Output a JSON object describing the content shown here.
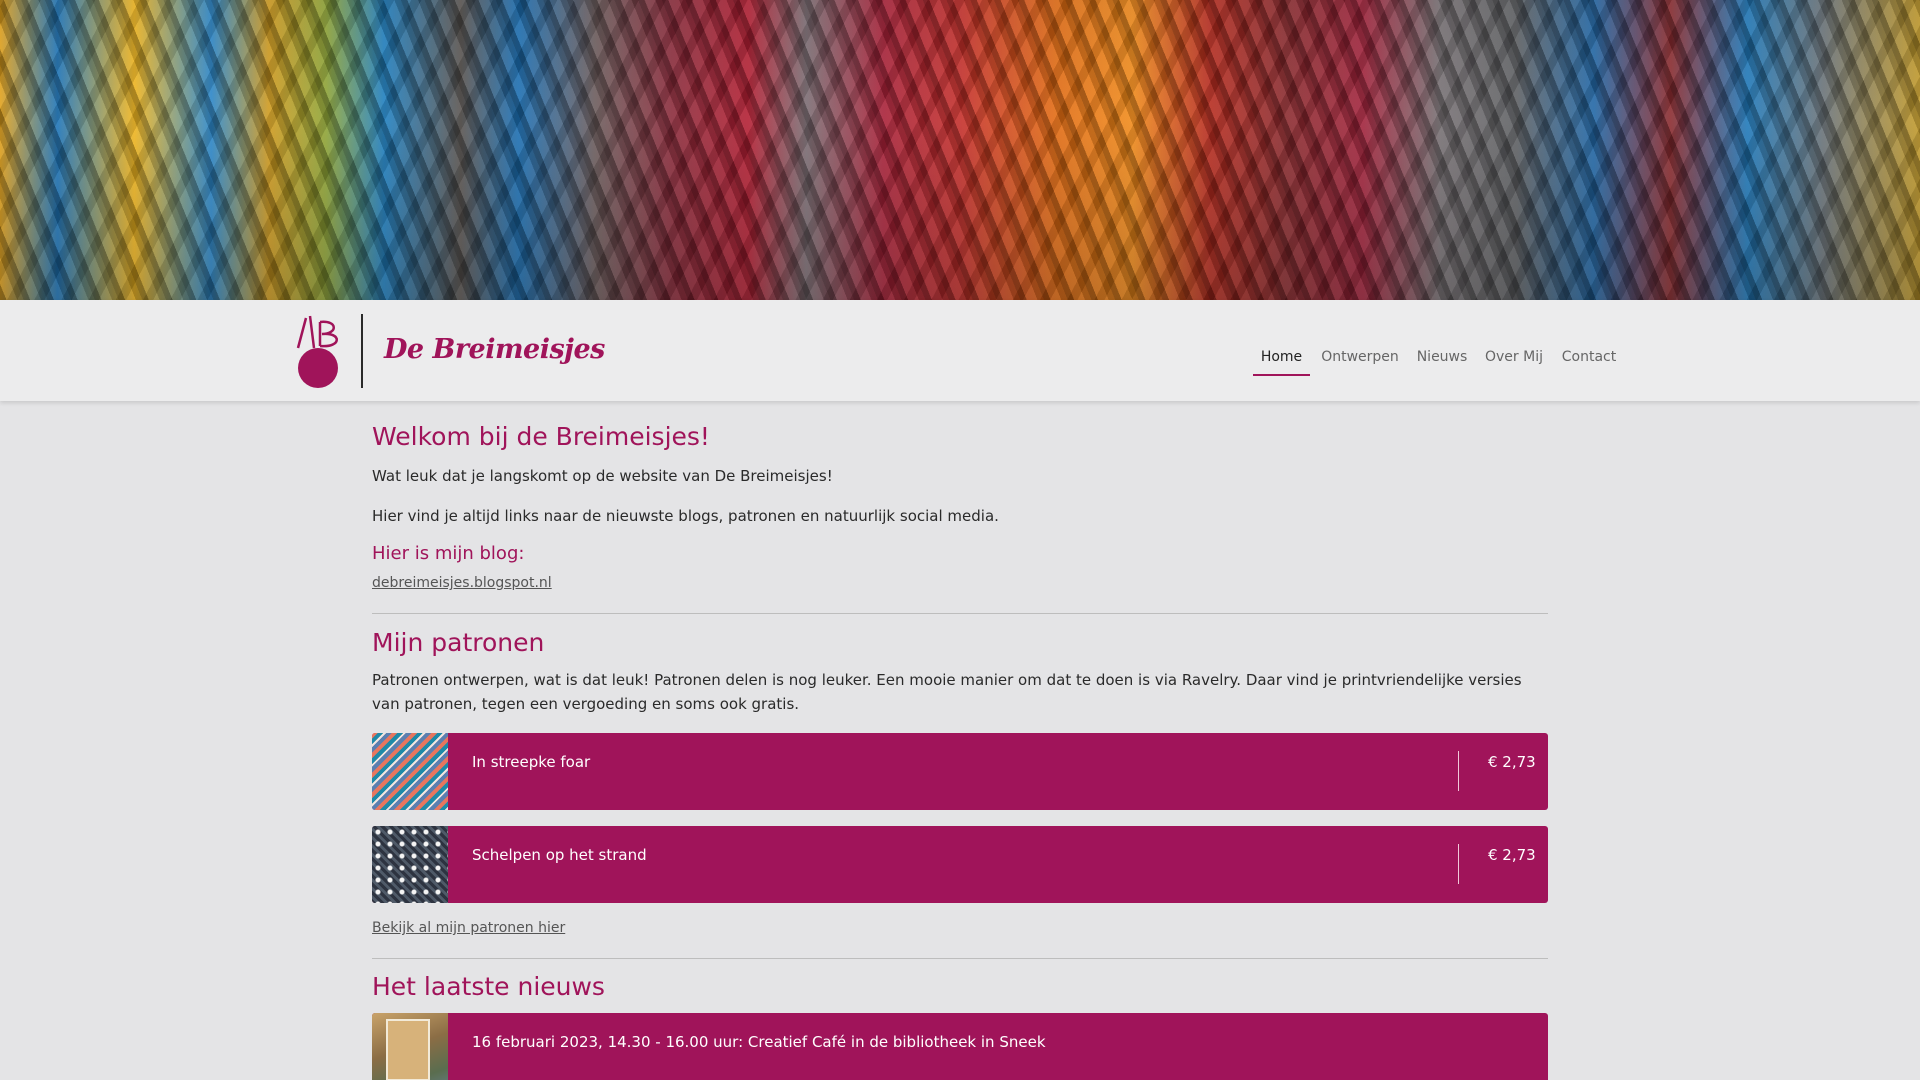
{
  "header": {
    "brand": "De Breimeisjes",
    "nav": [
      {
        "label": "Home",
        "active": true
      },
      {
        "label": "Ontwerpen",
        "active": false
      },
      {
        "label": "Nieuws",
        "active": false
      },
      {
        "label": "Over Mij",
        "active": false
      },
      {
        "label": "Contact",
        "active": false
      }
    ]
  },
  "welcome": {
    "title": "Welkom bij de Breimeisjes!",
    "intro": "Wat leuk dat je langskomt op de website van De Breimeisjes!",
    "body": "Hier vind je altijd links naar de nieuwste blogs, patronen en natuurlijk social media.",
    "blog_heading": "Hier is mijn blog:",
    "blog_link": "debreimeisjes.blogspot.nl"
  },
  "patterns": {
    "title": "Mijn patronen",
    "description": "Patronen ontwerpen, wat is dat leuk! Patronen delen is nog leuker. Een mooie manier om dat te doen is via Ravelry. Daar vind je printvriendelijke versies van patronen, tegen een vergoeding en soms ook gratis.",
    "items": [
      {
        "title": "In streepke foar",
        "price": "€ 2,73"
      },
      {
        "title": "Schelpen op het strand",
        "price": "€ 2,73"
      }
    ],
    "all_link": "Bekijk al mijn patronen hier"
  },
  "news": {
    "title": "Het laatste nieuws",
    "items": [
      {
        "title": "16 februari 2023, 14.30 - 16.00 uur: Creatief Café in de bibliotheek in Sneek"
      }
    ]
  },
  "colors": {
    "accent": "#a0145a",
    "background": "#e4e4e6",
    "header": "#ececed"
  }
}
